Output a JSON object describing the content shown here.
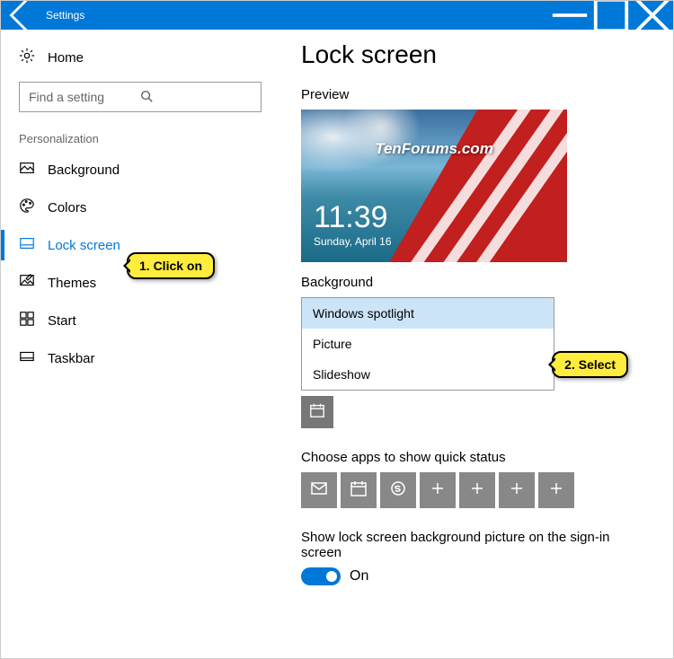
{
  "titlebar": {
    "title": "Settings"
  },
  "sidebar": {
    "home": "Home",
    "search_placeholder": "Find a setting",
    "category": "Personalization",
    "items": [
      {
        "label": "Background"
      },
      {
        "label": "Colors"
      },
      {
        "label": "Lock screen"
      },
      {
        "label": "Themes"
      },
      {
        "label": "Start"
      },
      {
        "label": "Taskbar"
      }
    ]
  },
  "content": {
    "heading": "Lock screen",
    "preview": {
      "label": "Preview",
      "watermark": "TenForums.com",
      "time": "11:39",
      "date": "Sunday, April 16"
    },
    "background": {
      "label": "Background",
      "options": [
        "Windows spotlight",
        "Picture",
        "Slideshow"
      ],
      "selected": "Windows spotlight"
    },
    "quickstatus": {
      "label": "Choose apps to show quick status",
      "tiles": [
        "mail-icon",
        "calendar-icon",
        "skype-icon",
        "plus-icon",
        "plus-icon",
        "plus-icon",
        "plus-icon"
      ]
    },
    "signin": {
      "label": "Show lock screen background picture on the sign-in screen",
      "state": "On"
    }
  },
  "annotations": {
    "step1": "1. Click on",
    "step2": "2. Select"
  }
}
